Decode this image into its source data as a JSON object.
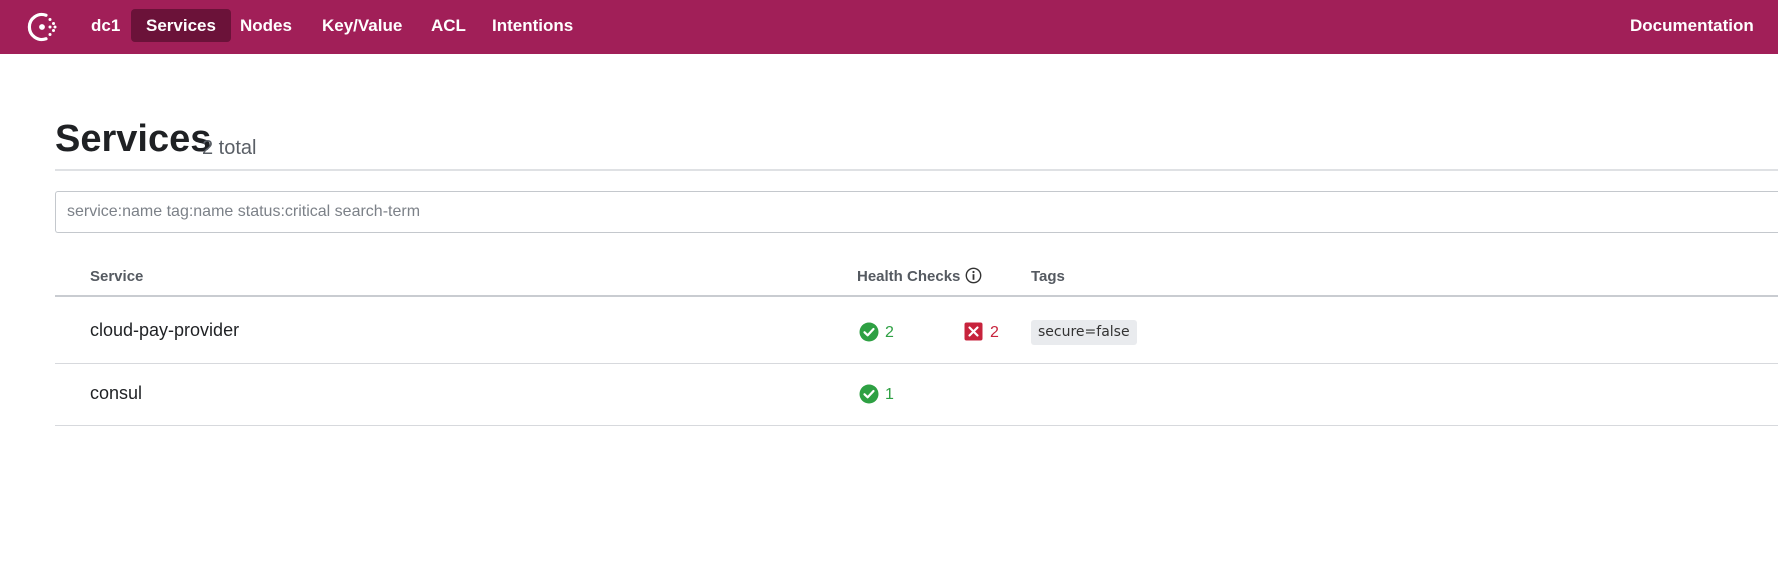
{
  "nav": {
    "datacenter": "dc1",
    "items": [
      {
        "label": "Services",
        "active": true
      },
      {
        "label": "Nodes",
        "active": false
      },
      {
        "label": "Key/Value",
        "active": false
      },
      {
        "label": "ACL",
        "active": false
      },
      {
        "label": "Intentions",
        "active": false
      }
    ],
    "documentation": "Documentation"
  },
  "page": {
    "title": "Services",
    "count": "2 total"
  },
  "search": {
    "placeholder": "service:name tag:name status:critical search-term",
    "value": ""
  },
  "table": {
    "headers": {
      "service": "Service",
      "health_checks": "Health Checks",
      "tags": "Tags"
    },
    "rows": [
      {
        "name": "cloud-pay-provider",
        "passing": "2",
        "failing": "2",
        "tags": [
          "secure=false"
        ]
      },
      {
        "name": "consul",
        "passing": "1",
        "failing": "",
        "tags": []
      }
    ]
  },
  "colors": {
    "brand": "#a11f58",
    "brand_active": "#6b1239",
    "passing": "#2ea043",
    "critical": "#c7233c"
  },
  "icons": {
    "logo": "consul-logo-icon",
    "info": "info-circle-icon",
    "passing": "check-circle-icon",
    "critical": "x-square-icon"
  }
}
